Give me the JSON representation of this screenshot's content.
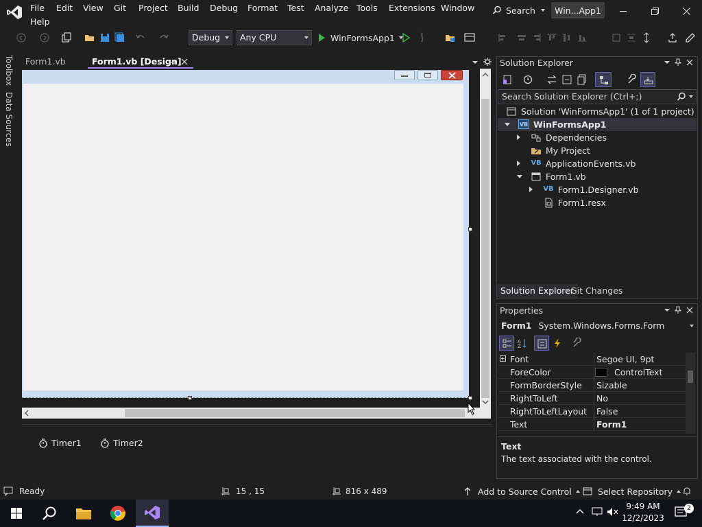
{
  "menu": {
    "file": "File",
    "edit": "Edit",
    "view": "View",
    "git": "Git",
    "project": "Project",
    "build": "Build",
    "debug": "Debug",
    "format": "Format",
    "test": "Test",
    "analyze": "Analyze",
    "tools": "Tools",
    "extensions": "Extensions",
    "window": "Window",
    "help": "Help"
  },
  "titlebar": {
    "search_label": "Search",
    "solution_badge": "Win...App1"
  },
  "toolbar": {
    "config": "Debug",
    "platform": "Any CPU",
    "start_label": "WinFormsApp1"
  },
  "left_rail": {
    "toolbox": "Toolbox",
    "data_sources": "Data Sources"
  },
  "doc_tabs": {
    "form1_vb": "Form1.vb",
    "form1_design": "Form1.vb [Design]"
  },
  "tray": {
    "timer1": "Timer1",
    "timer2": "Timer2"
  },
  "solution_explorer": {
    "title": "Solution Explorer",
    "search_placeholder": "Search Solution Explorer (Ctrl+;)",
    "solution": "Solution 'WinFormsApp1' (1 of 1 project)",
    "project": "WinFormsApp1",
    "dependencies": "Dependencies",
    "my_project": "My Project",
    "app_events": "ApplicationEvents.vb",
    "form1": "Form1.vb",
    "form1_designer": "Form1.Designer.vb",
    "form1_resx": "Form1.resx",
    "tab_solution": "Solution Explorer",
    "tab_git": "Git Changes"
  },
  "properties": {
    "title": "Properties",
    "object_name": "Form1",
    "object_type": "System.Windows.Forms.Form",
    "rows": [
      {
        "name": "Font",
        "value": "Segoe UI, 9pt"
      },
      {
        "name": "ForeColor",
        "value": "ControlText"
      },
      {
        "name": "FormBorderStyle",
        "value": "Sizable"
      },
      {
        "name": "RightToLeft",
        "value": "No"
      },
      {
        "name": "RightToLeftLayout",
        "value": "False"
      },
      {
        "name": "Text",
        "value": "Form1"
      }
    ],
    "desc_title": "Text",
    "desc_body": "The text associated with the control."
  },
  "status": {
    "ready": "Ready",
    "position": "15 , 15",
    "size": "816 x 489",
    "source_control": "Add to Source Control",
    "repo": "Select Repository"
  },
  "clock": {
    "time": "9:49 AM",
    "date": "12/2/2023"
  },
  "colors": {
    "accent": "#a887f0",
    "vb_blue": "#5ea5e0",
    "run_green": "#3bb44a"
  }
}
